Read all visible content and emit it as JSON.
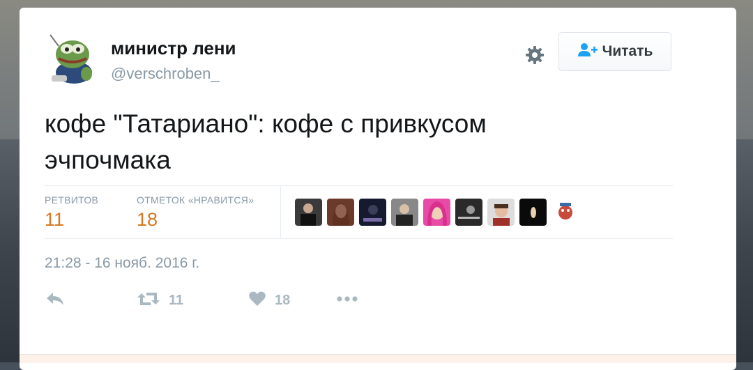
{
  "author": {
    "display_name": "министр лени",
    "handle": "@verschroben_",
    "avatar_icon": "pepe-frog-avatar"
  },
  "follow_button": {
    "label": "Читать",
    "icon": "add-user-icon"
  },
  "settings_icon": "gear-icon",
  "tweet": {
    "text": "кофе \"Татариано\": кофе с привкусом эчпочмака"
  },
  "stats": {
    "retweets_label": "РЕТВИТОВ",
    "retweets": "11",
    "likes_label": "ОТМЕТОК «НРАВИТСЯ»",
    "likes": "18"
  },
  "likers": [
    "liker-avatar-1",
    "liker-avatar-2",
    "liker-avatar-3",
    "liker-avatar-4",
    "liker-avatar-5",
    "liker-avatar-6",
    "liker-avatar-7",
    "liker-avatar-8",
    "liker-avatar-9"
  ],
  "timestamp": "21:28 - 16 нояб. 2016 г.",
  "actions": {
    "reply_icon": "reply-icon",
    "retweet_icon": "retweet-icon",
    "retweet_count": "11",
    "like_icon": "heart-icon",
    "like_count": "18",
    "more_icon": "more-dots-icon"
  },
  "colors": {
    "count_orange": "#d9771f",
    "muted": "#8899a6",
    "icon_gray": "#aab8c2",
    "link_blue": "#1da1f2"
  }
}
